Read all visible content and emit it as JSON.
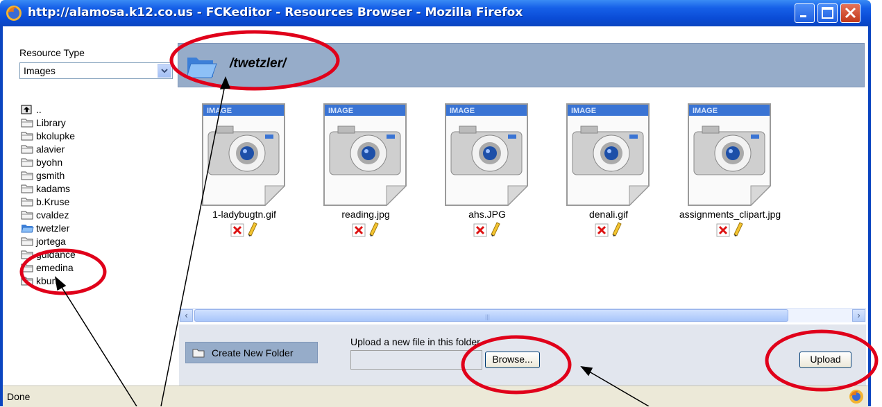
{
  "window": {
    "title": "http://alamosa.k12.co.us - FCKeditor - Resources Browser - Mozilla Firefox"
  },
  "sidebar": {
    "resource_type_label": "Resource Type",
    "resource_type_value": "Images",
    "up_label": "..",
    "folders": [
      "Library",
      "bkolupke",
      "alavier",
      "byohn",
      "gsmith",
      "kadams",
      "b.Kruse",
      "cvaldez",
      "twetzler",
      "jortega",
      "guidance",
      "emedina",
      "kburt"
    ],
    "selected_folder": "twetzler"
  },
  "main": {
    "current_path": "/twetzler/",
    "thumb_badge": "IMAGE",
    "files": [
      "1-ladybugtn.gif",
      "reading.jpg",
      "ahs.JPG",
      "denali.gif",
      "assignments_clipart.jpg"
    ]
  },
  "footer": {
    "create_folder_label": "Create New Folder",
    "upload_label": "Upload a new file in this folder",
    "browse_label": "Browse...",
    "upload_button_label": "Upload"
  },
  "status": {
    "text": "Done"
  },
  "colors": {
    "titlebar": "#0a4cd6",
    "panel": "#96acc9",
    "annotation": "#e0001a"
  }
}
